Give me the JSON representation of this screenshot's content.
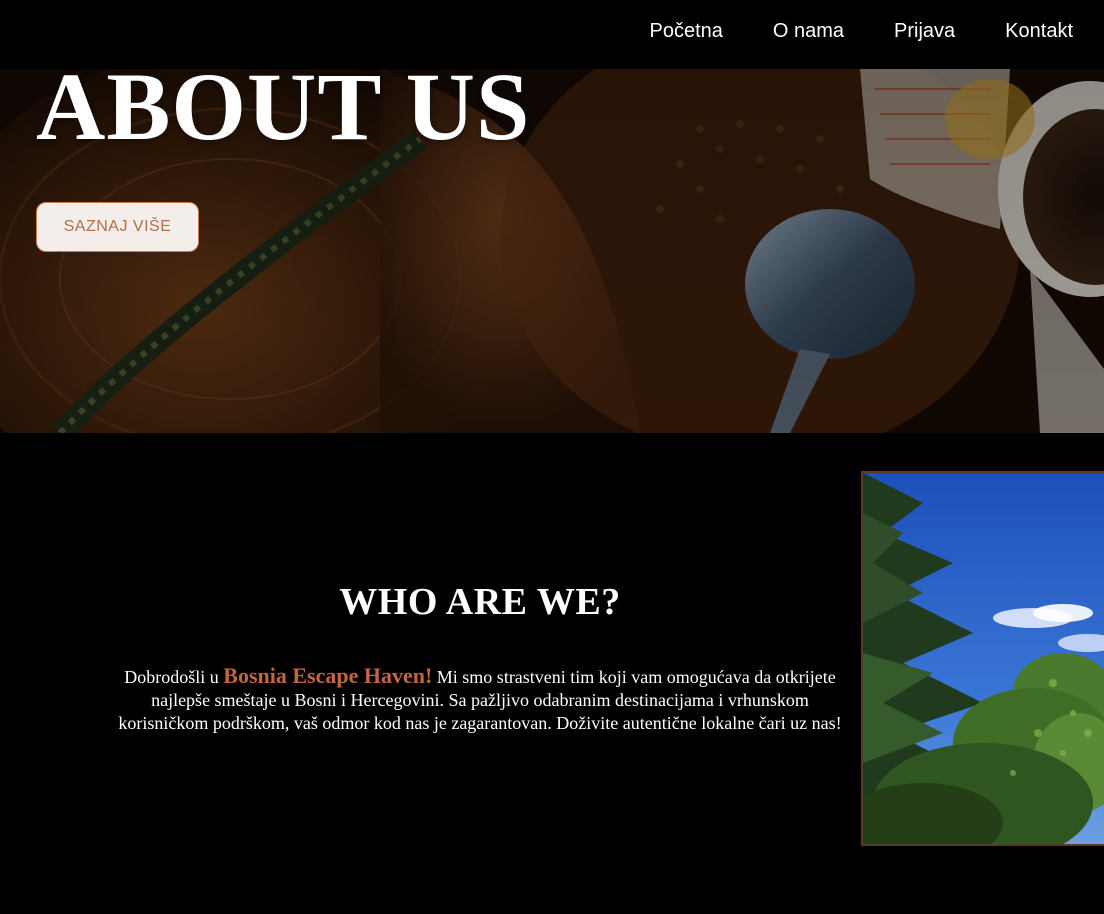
{
  "nav": {
    "items": [
      {
        "label": "Početna"
      },
      {
        "label": "O nama"
      },
      {
        "label": "Prijava"
      },
      {
        "label": "Kontakt"
      }
    ]
  },
  "hero": {
    "title": "ABOUT US",
    "button_label": "SAZNAJ VIŠE"
  },
  "about": {
    "heading": "WHO ARE WE?",
    "text_before": "Dobrodošli u ",
    "brand": "Bosnia Escape Haven!",
    "text_after": " Mi smo strastveni tim koji vam omogućava da otkrijete najlepše smeštaje u Bosni i Hercegovini. Sa pažljivo odabranim destinacijama i vrhunskom korisničkom podrškom, vaš odmor kod nas je zagarantovan. Doživite autentične lokalne čari uz nas!"
  },
  "colors": {
    "background": "#000000",
    "accent": "#c2663f",
    "button_bg": "#f4eeea"
  }
}
